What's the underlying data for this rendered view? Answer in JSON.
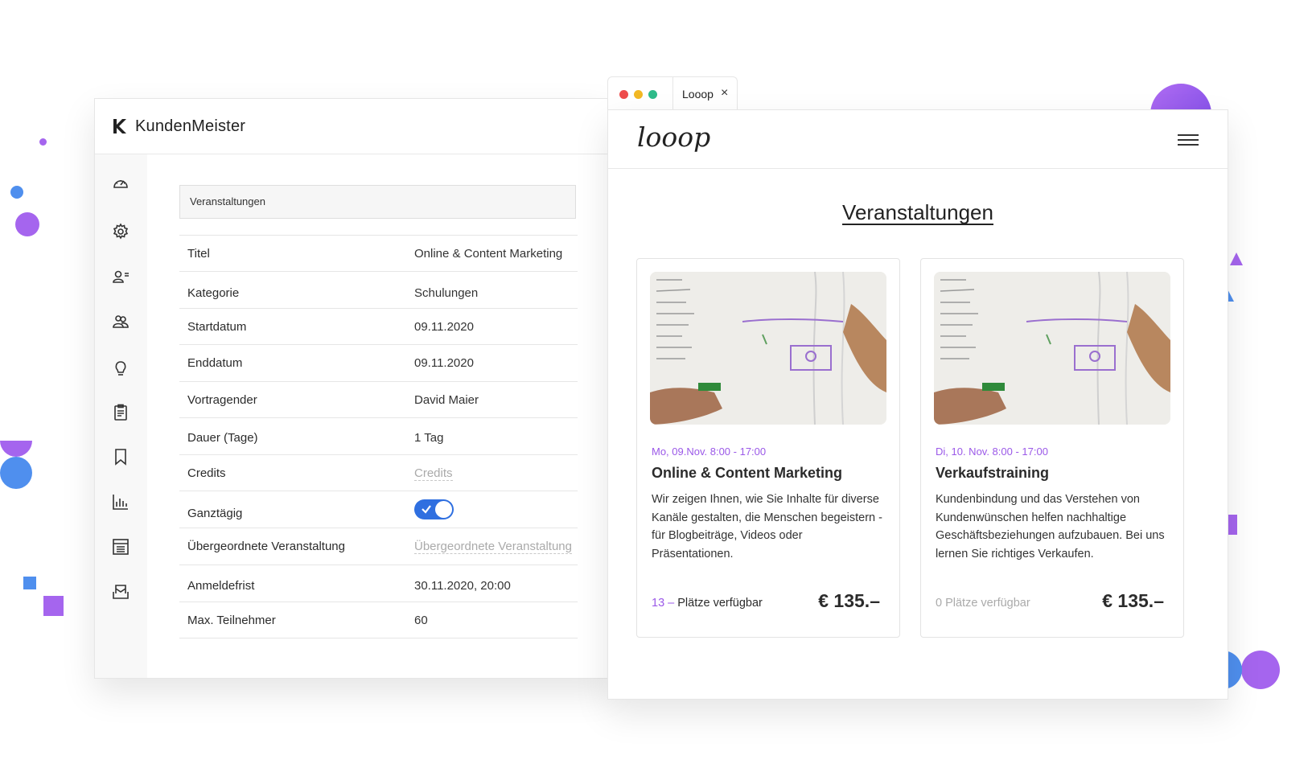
{
  "km": {
    "brand": "KundenMeister",
    "section_title": "Veranstaltungen",
    "sidebar": [
      "dashboard",
      "settings",
      "contacts",
      "groups",
      "ideas",
      "clipboard",
      "bookmark",
      "statistics",
      "list",
      "mail"
    ],
    "fields": [
      {
        "label": "Titel",
        "value": "Online & Content Marketing"
      },
      {
        "label": "Kategorie",
        "value": "Schulungen"
      },
      {
        "label": "Startdatum",
        "value": "09.11.2020"
      },
      {
        "label": "Enddatum",
        "value": "09.11.2020"
      },
      {
        "label": "Vortragender",
        "value": "David Maier"
      },
      {
        "label": "Dauer (Tage)",
        "value": "1 Tag"
      },
      {
        "label": "Credits",
        "placeholder": "Credits"
      },
      {
        "label": "Ganztägig",
        "toggle": true
      },
      {
        "label": "Übergeordnete Veranstaltung",
        "placeholder": "Übergeordnete Veranstaltung"
      },
      {
        "label": "Anmeldefrist",
        "value": "30.11.2020, 20:00"
      },
      {
        "label": "Max. Teilnehmer",
        "value": "60"
      }
    ]
  },
  "browser": {
    "tab_title": "Looop",
    "tab_close": "×",
    "logo": "looop",
    "page_title": "Veranstaltungen",
    "cards": [
      {
        "date": "Mo, 09.Nov. 8:00 - 17:00",
        "title": "Online & Content Marketing",
        "description": "Wir zeigen Ihnen, wie Sie Inhalte für diverse Kanäle gestalten, die Menschen begeistern - für Blogbeiträge, Videos oder Präsentationen.",
        "seats_number": "13 –",
        "seats_label": "Plätze verfügbar",
        "price": "€ 135.–"
      },
      {
        "date": "Di, 10. Nov. 8:00 - 17:00",
        "title": "Verkaufstraining",
        "description": "Kundenbindung und das Verstehen von Kundenwünschen helfen nachhaltige Geschäftsbeziehungen aufzubauen. Bei uns lernen Sie richtiges Verkaufen.",
        "seats_number": "",
        "seats_label": "0 Plätze verfügbar",
        "price": "€ 135.–"
      }
    ]
  },
  "colors": {
    "accent_purple": "#9b59e8",
    "accent_blue": "#2f6fe0"
  }
}
